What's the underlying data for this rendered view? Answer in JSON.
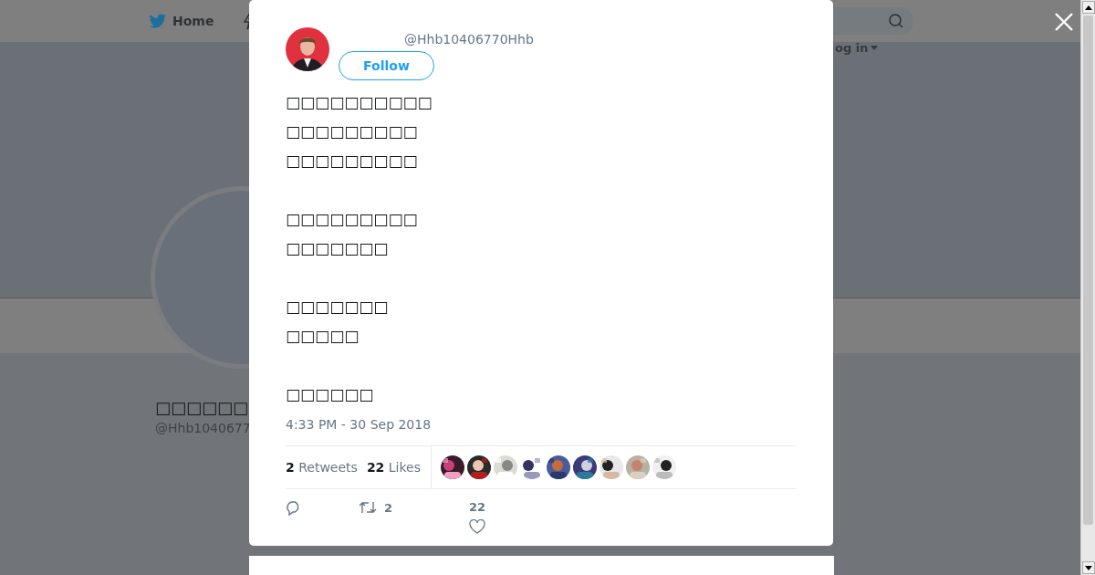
{
  "nav": {
    "home": "Home",
    "login": "og in"
  },
  "profile": {
    "name": "□□□□□□",
    "handle": "@Hhb1040677"
  },
  "tweet": {
    "handle": "@Hhb10406770Hhb",
    "follow": "Follow",
    "text": "□□□□□□□□□□\n□□□□□□□□□\n□□□□□□□□□\n\n□□□□□□□□□\n□□□□□□□\n\n□□□□□□□\n□□□□□\n\n□□□□□□",
    "time": "4:33 PM - 30 Sep 2018",
    "stats": [
      {
        "count": "2",
        "label": "Retweets"
      },
      {
        "count": "22",
        "label": "Likes"
      }
    ],
    "actions": [
      {
        "kind": "reply"
      },
      {
        "kind": "retweet",
        "count": "2"
      },
      {
        "kind": "like",
        "count": "22"
      }
    ]
  }
}
